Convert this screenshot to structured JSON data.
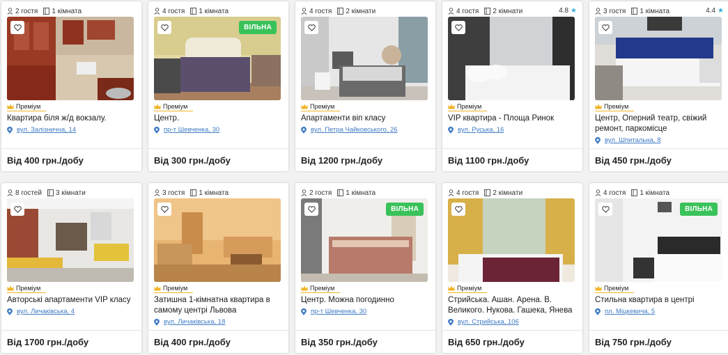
{
  "premium_label": "Преміум",
  "listings": [
    {
      "guests": "2 гостя",
      "rooms": "1 кімната",
      "rating": "",
      "available": "",
      "title": "Квартира біля ж/д вокзалу.",
      "address": "вул. Залізнична, 14",
      "price": "Від 400 грн./добу"
    },
    {
      "guests": "4 гостя",
      "rooms": "1 кімната",
      "rating": "",
      "available": "ВІЛЬНА",
      "title": "Центр.",
      "address": "пр-т Шевченка, 30",
      "price": "Від 300 грн./добу"
    },
    {
      "guests": "4 гостя",
      "rooms": "2 кімнати",
      "rating": "",
      "available": "",
      "title": "Апартаменти віп класу",
      "address": "вул. Петра Чайковського, 26",
      "price": "Від 1200 грн./добу"
    },
    {
      "guests": "4 гостя",
      "rooms": "2 кімнати",
      "rating": "4.8",
      "available": "",
      "title": "VIP квартира - Площа Ринок",
      "address": "вул. Руська, 16",
      "price": "Від 1100 грн./добу"
    },
    {
      "guests": "3 гостя",
      "rooms": "1 кімната",
      "rating": "4.4",
      "available": "",
      "title": "Центр, Оперний театр, свіжий ремонт, паркомісце",
      "address": "вул. Шпитальна, 8",
      "price": "Від 450 грн./добу"
    },
    {
      "guests": "8 гостей",
      "rooms": "3 кімнати",
      "rating": "",
      "available": "",
      "title": "Авторські апартаменти VIP класу",
      "address": "вул. Личаківська, 4",
      "price": "Від 1700 грн./добу"
    },
    {
      "guests": "3 гостя",
      "rooms": "1 кімната",
      "rating": "",
      "available": "",
      "title": "Затишна 1-кімнатна квартира в самому центрі Львова",
      "address": "вул. Личаківська, 18",
      "price": "Від 400 грн./добу"
    },
    {
      "guests": "2 гостя",
      "rooms": "1 кімната",
      "rating": "",
      "available": "ВІЛЬНА",
      "title": "Центр. Можна погодинно",
      "address": "пр-т Шевченка, 30",
      "price": "Від 350 грн./добу"
    },
    {
      "guests": "4 гостя",
      "rooms": "2 кімнати",
      "rating": "",
      "available": "",
      "title": "Стрийська. Ашан. Арена. В. Великого. Нукова. Гашека, Янева",
      "address": "вул. Стрийська, 106",
      "price": "Від 650 грн./добу"
    },
    {
      "guests": "4 гостя",
      "rooms": "1 кімната",
      "rating": "",
      "available": "ВІЛЬНА",
      "title": "Стильна квартира в центрі",
      "address": "пл. Міцкевича, 5",
      "price": "Від 750 грн./добу"
    }
  ],
  "colors": {
    "accent_link": "#3f7bc4",
    "available_badge": "#3ac25a",
    "premium_line": "#f0b323",
    "rating_star": "#3aaed8"
  }
}
